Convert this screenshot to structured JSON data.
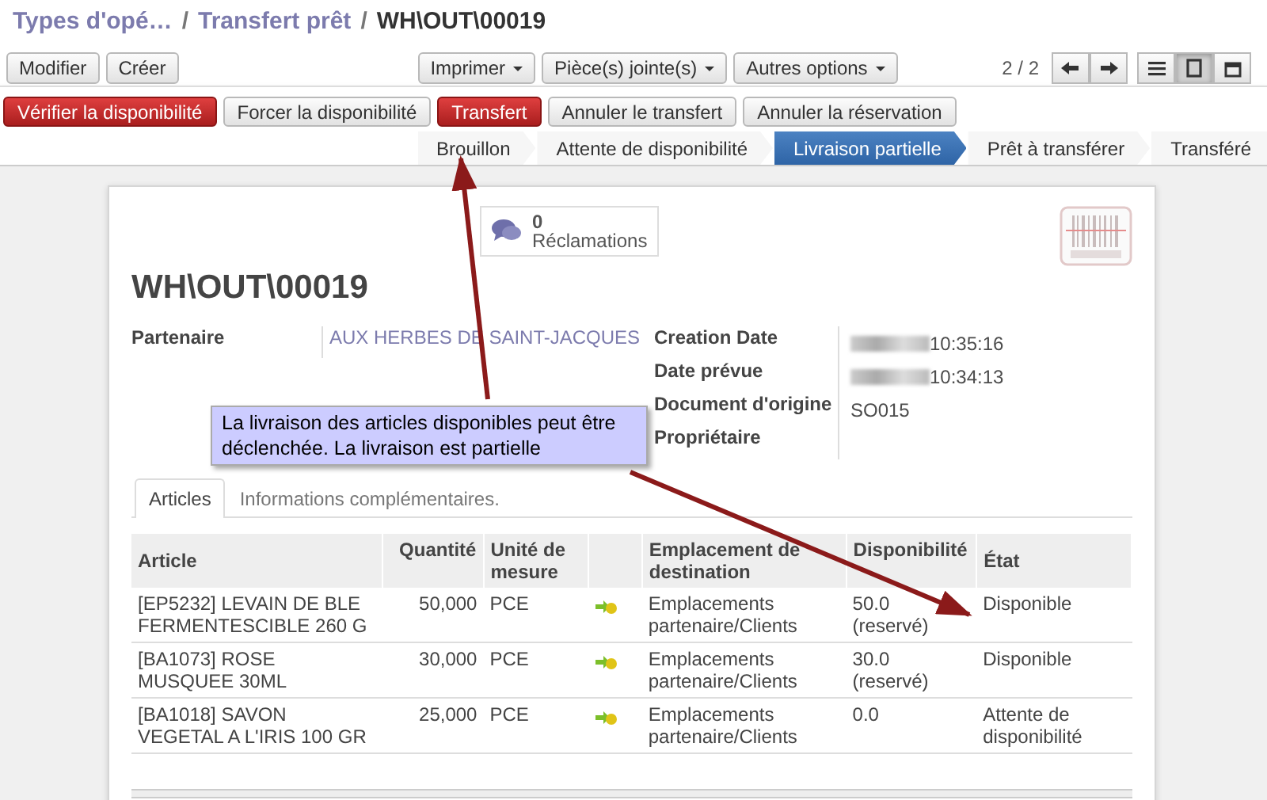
{
  "breadcrumb": [
    {
      "label": "Types d'opé…",
      "kind": "link"
    },
    {
      "label": "/",
      "kind": "separator"
    },
    {
      "label": "Transfert prêt",
      "kind": "link"
    },
    {
      "label": "/",
      "kind": "separator"
    },
    {
      "label": "WH\\OUT\\00019",
      "kind": "current"
    }
  ],
  "toolbar": {
    "left_buttons": [
      "Modifier",
      "Créer"
    ],
    "dropdowns": [
      "Imprimer",
      "Pièce(s) jointe(s)",
      "Autres options"
    ],
    "pager": "2 / 2",
    "views": [
      {
        "kind": "list",
        "selected": false
      },
      {
        "kind": "form",
        "selected": true
      },
      {
        "kind": "calendar",
        "selected": false
      }
    ]
  },
  "actions": [
    {
      "label": "Vérifier la disponibilité",
      "primary": true
    },
    {
      "label": "Forcer la disponibilité",
      "primary": false
    },
    {
      "label": "Transfert",
      "primary": true
    },
    {
      "label": "Annuler le transfert",
      "primary": false
    },
    {
      "label": "Annuler la réservation",
      "primary": false
    }
  ],
  "stages": [
    {
      "label": "Brouillon",
      "selected": false
    },
    {
      "label": "Attente de disponibilité",
      "selected": false
    },
    {
      "label": "Livraison partielle",
      "selected": true
    },
    {
      "label": "Prêt à transférer",
      "selected": false
    },
    {
      "label": "Transféré",
      "selected": false
    }
  ],
  "sheet": {
    "reclamations": {
      "count": "0",
      "label": "Réclamations"
    },
    "title": "WH\\OUT\\00019",
    "left_fields": [
      {
        "label": "Partenaire",
        "value": "AUX HERBES DE SAINT-JACQUES",
        "kind": "link"
      }
    ],
    "right_fields": [
      {
        "label": "Creation Date",
        "value": "10:35:16",
        "blurred": true
      },
      {
        "label": "Date prévue",
        "value": "10:34:13",
        "blurred": true
      },
      {
        "label": "Document d'origine",
        "value": "SO015"
      },
      {
        "label": "Propriétaire"
      }
    ],
    "tabs": [
      {
        "label": "Articles",
        "selected": true
      },
      {
        "label": "Informations complémentaires.",
        "selected": false
      }
    ],
    "table": {
      "columns": [
        "Article",
        "Quantité",
        "Unité de mesure",
        "",
        "Emplacement de destination",
        "Disponibilité",
        "État"
      ],
      "rows": [
        {
          "article": "[EP5232] LEVAIN DE BLE FERMENTESCIBLE 260 G",
          "quantity": "50,000",
          "unit": "PCE",
          "destination": "Emplacements partenaire/Clients",
          "availability": "50.0 (reservé)",
          "state": "Disponible"
        },
        {
          "article": "[BA1073] ROSE MUSQUEE 30ML",
          "quantity": "30,000",
          "unit": "PCE",
          "destination": "Emplacements partenaire/Clients",
          "availability": "30.0 (reservé)",
          "state": "Disponible"
        },
        {
          "article": "[BA1018] SAVON VEGETAL A L'IRIS 100 GR",
          "quantity": "25,000",
          "unit": "PCE",
          "destination": "Emplacements partenaire/Clients",
          "availability": "0.0",
          "state": "Attente de disponibilité"
        }
      ]
    }
  },
  "annotation": {
    "note": "La livraison des articles disponibles peut être déclenchée. La livraison est partielle"
  }
}
